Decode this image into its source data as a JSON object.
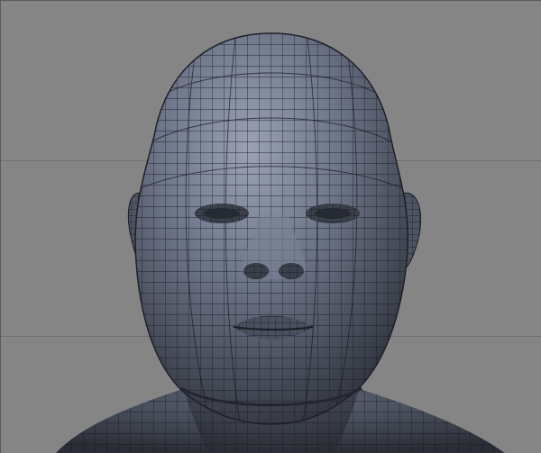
{
  "viewport": {
    "background": "#858585",
    "mesh_fill": "#5f6777",
    "mesh_wire": "#1a1c22",
    "content": "wireframe-head-mesh"
  }
}
